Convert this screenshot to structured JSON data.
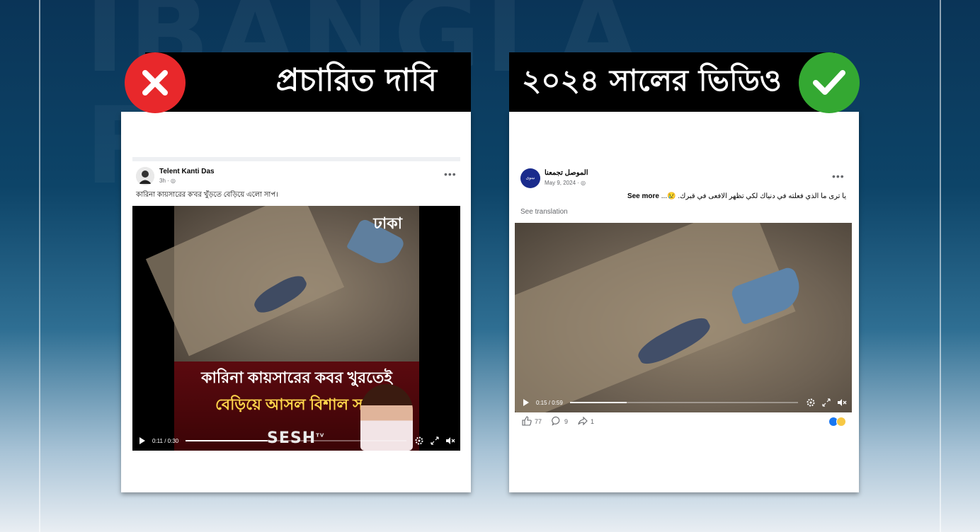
{
  "watermark": {
    "line1": "IBANGLA",
    "line2": "FACT"
  },
  "left": {
    "banner_title": "প্রচারিত দাবি",
    "badge": "cross-icon",
    "post": {
      "author": "Telent Kanti Das",
      "meta": "3h · ",
      "text": "কারিনা কায়সারের ক'বর খুঁড়তে বেড়িয়ে এলো সাপ।",
      "video": {
        "logo": "ঢাকা",
        "caption_line1": "কারিনা কায়সারের কবর খুরতেই",
        "caption_line2": "বেড়িয়ে আসল বিশাল সাপ",
        "brand": "SESH",
        "brand_tv": "TV",
        "time": "0:11 / 0:30",
        "progress": 0.37
      }
    }
  },
  "right": {
    "banner_title": "২০২৪ সালের ভিডিও",
    "badge": "check-icon",
    "post": {
      "author": "الموصل تجمعنا",
      "meta": "May 9, 2024 · ",
      "avatar_text": "نينوى",
      "text": "يا ترى ما الذي فعلته في دنياك لكي تظهر الافعى في قبرك. 😢...",
      "see_more": "See more",
      "see_translation": "See translation",
      "video": {
        "time": "0:15 / 0:59",
        "progress": 0.25
      },
      "reactions": {
        "likes": "77",
        "comments": "9",
        "shares": "1"
      }
    }
  },
  "colors": {
    "cross": "#e8282b",
    "check": "#34a832",
    "banner": "#000000"
  }
}
